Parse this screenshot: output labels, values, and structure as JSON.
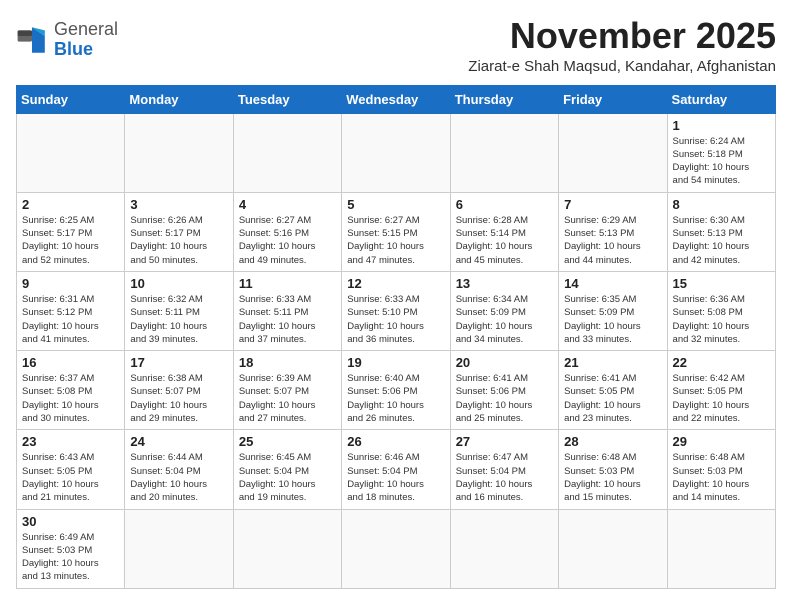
{
  "header": {
    "logo_general": "General",
    "logo_blue": "Blue",
    "month_title": "November 2025",
    "subtitle": "Ziarat-e Shah Maqsud, Kandahar, Afghanistan"
  },
  "weekdays": [
    "Sunday",
    "Monday",
    "Tuesday",
    "Wednesday",
    "Thursday",
    "Friday",
    "Saturday"
  ],
  "weeks": [
    [
      {
        "day": "",
        "info": ""
      },
      {
        "day": "",
        "info": ""
      },
      {
        "day": "",
        "info": ""
      },
      {
        "day": "",
        "info": ""
      },
      {
        "day": "",
        "info": ""
      },
      {
        "day": "",
        "info": ""
      },
      {
        "day": "1",
        "info": "Sunrise: 6:24 AM\nSunset: 5:18 PM\nDaylight: 10 hours\nand 54 minutes."
      }
    ],
    [
      {
        "day": "2",
        "info": "Sunrise: 6:25 AM\nSunset: 5:17 PM\nDaylight: 10 hours\nand 52 minutes."
      },
      {
        "day": "3",
        "info": "Sunrise: 6:26 AM\nSunset: 5:17 PM\nDaylight: 10 hours\nand 50 minutes."
      },
      {
        "day": "4",
        "info": "Sunrise: 6:27 AM\nSunset: 5:16 PM\nDaylight: 10 hours\nand 49 minutes."
      },
      {
        "day": "5",
        "info": "Sunrise: 6:27 AM\nSunset: 5:15 PM\nDaylight: 10 hours\nand 47 minutes."
      },
      {
        "day": "6",
        "info": "Sunrise: 6:28 AM\nSunset: 5:14 PM\nDaylight: 10 hours\nand 45 minutes."
      },
      {
        "day": "7",
        "info": "Sunrise: 6:29 AM\nSunset: 5:13 PM\nDaylight: 10 hours\nand 44 minutes."
      },
      {
        "day": "8",
        "info": "Sunrise: 6:30 AM\nSunset: 5:13 PM\nDaylight: 10 hours\nand 42 minutes."
      }
    ],
    [
      {
        "day": "9",
        "info": "Sunrise: 6:31 AM\nSunset: 5:12 PM\nDaylight: 10 hours\nand 41 minutes."
      },
      {
        "day": "10",
        "info": "Sunrise: 6:32 AM\nSunset: 5:11 PM\nDaylight: 10 hours\nand 39 minutes."
      },
      {
        "day": "11",
        "info": "Sunrise: 6:33 AM\nSunset: 5:11 PM\nDaylight: 10 hours\nand 37 minutes."
      },
      {
        "day": "12",
        "info": "Sunrise: 6:33 AM\nSunset: 5:10 PM\nDaylight: 10 hours\nand 36 minutes."
      },
      {
        "day": "13",
        "info": "Sunrise: 6:34 AM\nSunset: 5:09 PM\nDaylight: 10 hours\nand 34 minutes."
      },
      {
        "day": "14",
        "info": "Sunrise: 6:35 AM\nSunset: 5:09 PM\nDaylight: 10 hours\nand 33 minutes."
      },
      {
        "day": "15",
        "info": "Sunrise: 6:36 AM\nSunset: 5:08 PM\nDaylight: 10 hours\nand 32 minutes."
      }
    ],
    [
      {
        "day": "16",
        "info": "Sunrise: 6:37 AM\nSunset: 5:08 PM\nDaylight: 10 hours\nand 30 minutes."
      },
      {
        "day": "17",
        "info": "Sunrise: 6:38 AM\nSunset: 5:07 PM\nDaylight: 10 hours\nand 29 minutes."
      },
      {
        "day": "18",
        "info": "Sunrise: 6:39 AM\nSunset: 5:07 PM\nDaylight: 10 hours\nand 27 minutes."
      },
      {
        "day": "19",
        "info": "Sunrise: 6:40 AM\nSunset: 5:06 PM\nDaylight: 10 hours\nand 26 minutes."
      },
      {
        "day": "20",
        "info": "Sunrise: 6:41 AM\nSunset: 5:06 PM\nDaylight: 10 hours\nand 25 minutes."
      },
      {
        "day": "21",
        "info": "Sunrise: 6:41 AM\nSunset: 5:05 PM\nDaylight: 10 hours\nand 23 minutes."
      },
      {
        "day": "22",
        "info": "Sunrise: 6:42 AM\nSunset: 5:05 PM\nDaylight: 10 hours\nand 22 minutes."
      }
    ],
    [
      {
        "day": "23",
        "info": "Sunrise: 6:43 AM\nSunset: 5:05 PM\nDaylight: 10 hours\nand 21 minutes."
      },
      {
        "day": "24",
        "info": "Sunrise: 6:44 AM\nSunset: 5:04 PM\nDaylight: 10 hours\nand 20 minutes."
      },
      {
        "day": "25",
        "info": "Sunrise: 6:45 AM\nSunset: 5:04 PM\nDaylight: 10 hours\nand 19 minutes."
      },
      {
        "day": "26",
        "info": "Sunrise: 6:46 AM\nSunset: 5:04 PM\nDaylight: 10 hours\nand 18 minutes."
      },
      {
        "day": "27",
        "info": "Sunrise: 6:47 AM\nSunset: 5:04 PM\nDaylight: 10 hours\nand 16 minutes."
      },
      {
        "day": "28",
        "info": "Sunrise: 6:48 AM\nSunset: 5:03 PM\nDaylight: 10 hours\nand 15 minutes."
      },
      {
        "day": "29",
        "info": "Sunrise: 6:48 AM\nSunset: 5:03 PM\nDaylight: 10 hours\nand 14 minutes."
      }
    ],
    [
      {
        "day": "30",
        "info": "Sunrise: 6:49 AM\nSunset: 5:03 PM\nDaylight: 10 hours\nand 13 minutes."
      },
      {
        "day": "",
        "info": ""
      },
      {
        "day": "",
        "info": ""
      },
      {
        "day": "",
        "info": ""
      },
      {
        "day": "",
        "info": ""
      },
      {
        "day": "",
        "info": ""
      },
      {
        "day": "",
        "info": ""
      }
    ]
  ]
}
